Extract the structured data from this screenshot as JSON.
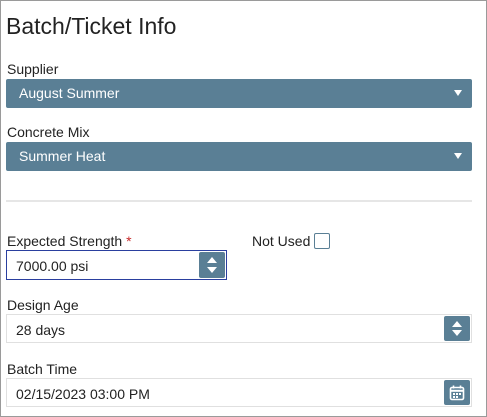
{
  "title": "Batch/Ticket Info",
  "supplier": {
    "label": "Supplier",
    "value": "August Summer"
  },
  "concrete_mix": {
    "label": "Concrete Mix",
    "value": "Summer Heat"
  },
  "expected_strength": {
    "label": "Expected Strength",
    "required_marker": "*",
    "value": "7000.00 psi"
  },
  "not_used": {
    "label": "Not Used",
    "checked": false
  },
  "design_age": {
    "label": "Design Age",
    "value": "28 days"
  },
  "batch_time": {
    "label": "Batch Time",
    "value": "02/15/2023 03:00 PM"
  },
  "colors": {
    "accent": "#5a7f95",
    "focus_border": "#2a3f9f",
    "required": "#c62828"
  },
  "icons": [
    "caret-down-icon",
    "spin-up-icon",
    "spin-down-icon",
    "calendar-icon"
  ]
}
